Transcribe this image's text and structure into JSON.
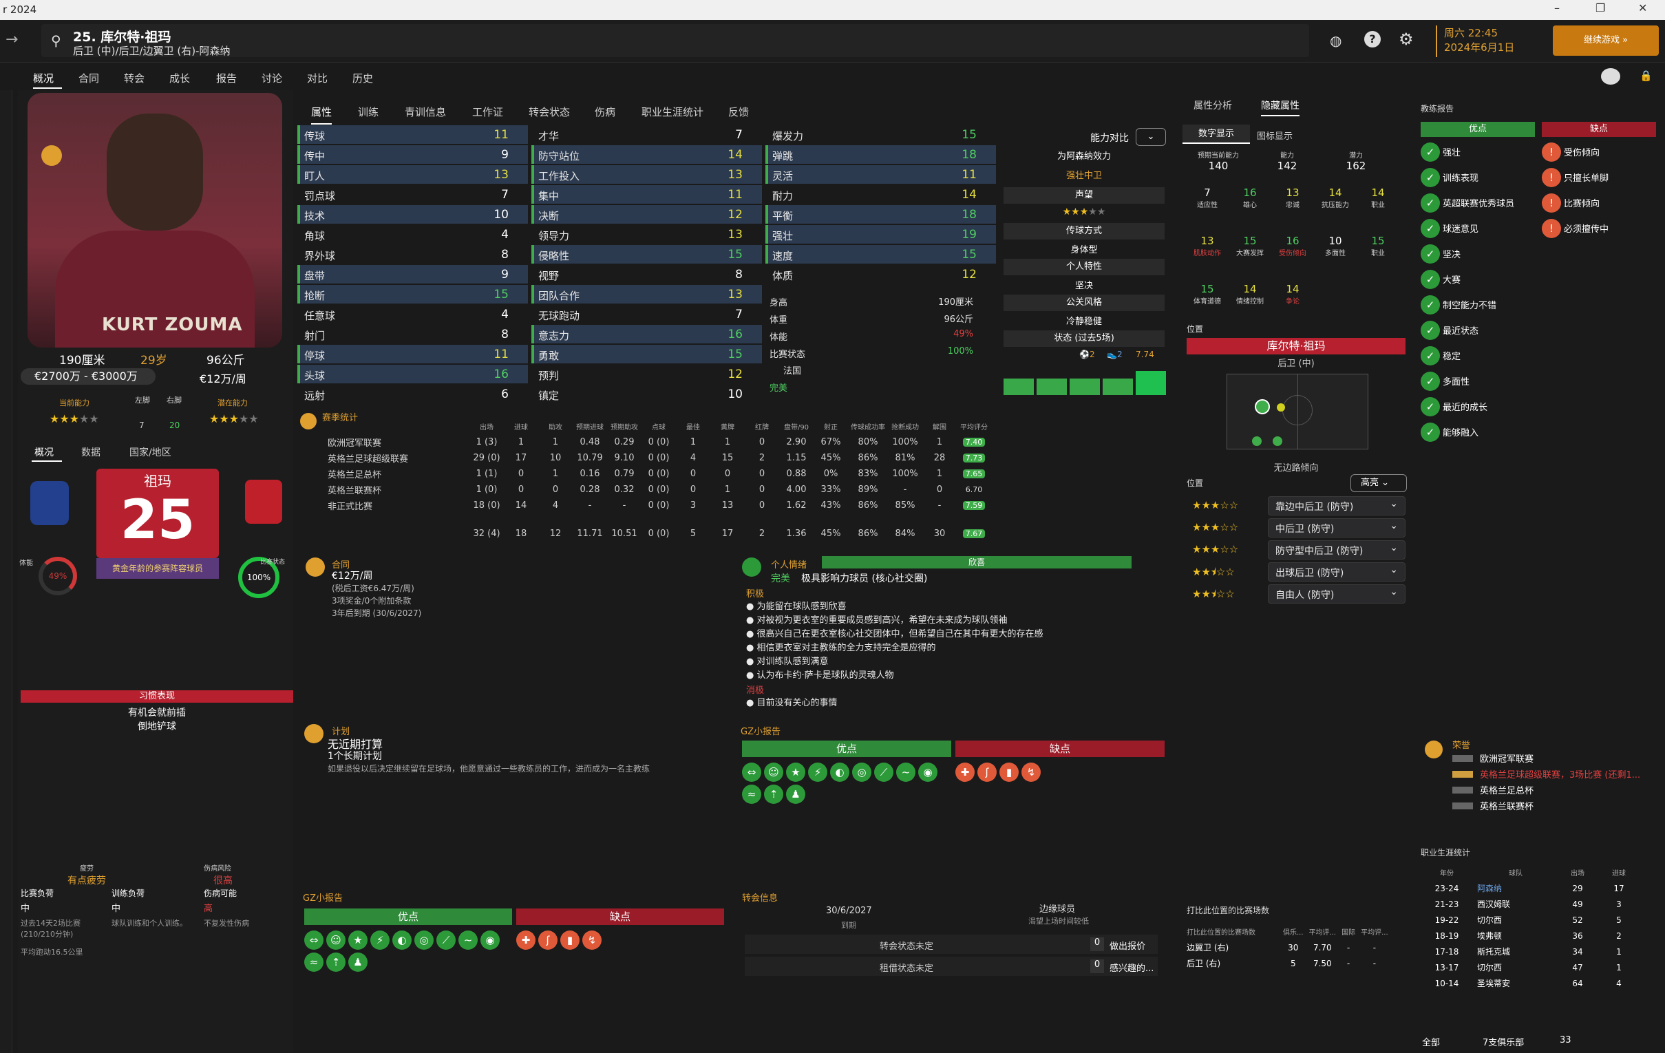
{
  "window": {
    "title": "r 2024"
  },
  "header": {
    "player_title": "25. 库尔特·祖玛",
    "positions": "后卫 (中)/后卫/边翼卫 (右)-阿森纳",
    "datetime_day": "周六 22:45",
    "datetime_date": "2024年6月1日",
    "continue_label": "继续游戏"
  },
  "nav": [
    "概况",
    "合同",
    "转会",
    "成长",
    "报告",
    "讨论",
    "对比",
    "历史"
  ],
  "profile": {
    "photo_name": "KURT ZOUMA",
    "height": "190厘米",
    "age": "29岁",
    "weight": "96公斤",
    "value": "€2700万 - €3000万",
    "wage": "€12万/周",
    "current_ability_label": "当前能力",
    "potential_ability_label": "潜在能力",
    "left_foot_label": "左脚",
    "right_foot_label": "右脚",
    "left_foot": "7",
    "right_foot": "20",
    "tabs": [
      "概况",
      "数据",
      "国家/地区"
    ],
    "kit_name": "祖玛",
    "kit_number": "25",
    "status_label": "黄金年龄的参赛阵容球员",
    "morale_label": "体能",
    "morale_pct": "49%",
    "match_label": "比赛状态",
    "match_pct": "100%",
    "habits_title": "习惯表现",
    "habits": [
      "有机会就前插",
      "倒地铲球"
    ],
    "fatigue_label": "疲劳",
    "fatigue_val": "有点疲劳",
    "injury_label": "伤病风险",
    "injury_val": "很高",
    "load_labels": [
      "比赛负荷",
      "训练负荷",
      "伤病可能"
    ],
    "load_vals": [
      "中",
      "中",
      "高"
    ],
    "load_notes": [
      "过去14天2场比赛 (210/210分钟)",
      "球队训练和个人训练。",
      "不复发性伤病"
    ],
    "avg_run": "平均跑动16.5公里"
  },
  "attr_tabs": [
    "属性",
    "训练",
    "青训信息",
    "工作证",
    "转会状态",
    "伤病",
    "职业生涯统计",
    "反馈"
  ],
  "attrs_tech": [
    [
      "传球",
      "11"
    ],
    [
      "传中",
      "9"
    ],
    [
      "盯人",
      "13"
    ],
    [
      "罚点球",
      "7"
    ],
    [
      "技术",
      "10"
    ],
    [
      "角球",
      "4"
    ],
    [
      "界外球",
      "8"
    ],
    [
      "盘带",
      "9"
    ],
    [
      "抢断",
      "15"
    ],
    [
      "任意球",
      "4"
    ],
    [
      "射门",
      "8"
    ],
    [
      "停球",
      "11"
    ],
    [
      "头球",
      "16"
    ],
    [
      "远射",
      "6"
    ]
  ],
  "attrs_mental": [
    [
      "才华",
      "7"
    ],
    [
      "防守站位",
      "14"
    ],
    [
      "工作投入",
      "13"
    ],
    [
      "集中",
      "11"
    ],
    [
      "决断",
      "12"
    ],
    [
      "领导力",
      "13"
    ],
    [
      "侵略性",
      "15"
    ],
    [
      "视野",
      "8"
    ],
    [
      "团队合作",
      "13"
    ],
    [
      "无球跑动",
      "7"
    ],
    [
      "意志力",
      "16"
    ],
    [
      "勇敢",
      "15"
    ],
    [
      "预判",
      "12"
    ],
    [
      "镇定",
      "10"
    ]
  ],
  "attrs_phys": [
    [
      "爆发力",
      "15"
    ],
    [
      "弹跳",
      "18"
    ],
    [
      "灵活",
      "11"
    ],
    [
      "耐力",
      "14"
    ],
    [
      "平衡",
      "18"
    ],
    [
      "强壮",
      "19"
    ],
    [
      "速度",
      "15"
    ],
    [
      "体质",
      "12"
    ]
  ],
  "phys_info": [
    [
      "身高",
      "190厘米"
    ],
    [
      "体重",
      "96公斤"
    ],
    [
      "体能",
      "49%"
    ],
    [
      "比赛状态",
      "100%"
    ],
    [
      "",
      "法国"
    ],
    [
      "",
      "完美"
    ]
  ],
  "compare": {
    "label": "能力对比",
    "efficiency": "为阿森纳效力",
    "role": "强壮中卫",
    "rep_label": "声望",
    "style_label": "传球方式",
    "style_val": "身体型",
    "trait_label": "个人特性",
    "trait_val": "坚决",
    "pers_label": "公关风格",
    "pers_val": "冷静稳健",
    "form_label": "状态 (过去5场)",
    "form_goals": "2",
    "form_assists": "2",
    "form_rating": "7.74",
    "form_bars": [
      0.5,
      0.5,
      0.5,
      0.5,
      0.72
    ]
  },
  "season_stats": {
    "title": "赛季统计",
    "headers": [
      "出场",
      "进球",
      "助攻",
      "预期进球",
      "预期助攻",
      "点球",
      "最佳",
      "黄牌",
      "红牌",
      "盘带/90",
      "射正",
      "传球成功率",
      "抢断成功",
      "解围",
      "平均评分"
    ],
    "rows": [
      {
        "comp": "欧洲冠军联赛",
        "cells": [
          "1 (3)",
          "1",
          "1",
          "0.48",
          "0.29",
          "0 (0)",
          "1",
          "1",
          "0",
          "2.90",
          "67%",
          "80%",
          "100%",
          "1"
        ],
        "rating": "7.40"
      },
      {
        "comp": "英格兰足球超级联赛",
        "cells": [
          "29 (0)",
          "17",
          "10",
          "10.79",
          "9.10",
          "0 (0)",
          "4",
          "15",
          "2",
          "1.15",
          "45%",
          "86%",
          "81%",
          "28"
        ],
        "rating": "7.73"
      },
      {
        "comp": "英格兰足总杯",
        "cells": [
          "1 (1)",
          "0",
          "1",
          "0.16",
          "0.79",
          "0 (0)",
          "0",
          "0",
          "0",
          "0.88",
          "0%",
          "83%",
          "100%",
          "1"
        ],
        "rating": "7.65"
      },
      {
        "comp": "英格兰联赛杯",
        "cells": [
          "1 (0)",
          "0",
          "0",
          "0.28",
          "0.32",
          "0 (0)",
          "0",
          "1",
          "0",
          "4.00",
          "33%",
          "89%",
          "-",
          "0"
        ],
        "rating": "6.70"
      },
      {
        "comp": "非正式比赛",
        "cells": [
          "18 (0)",
          "14",
          "4",
          "-",
          "-",
          "0 (0)",
          "3",
          "13",
          "0",
          "1.62",
          "43%",
          "86%",
          "85%",
          "-"
        ],
        "rating": "7.59"
      }
    ],
    "total": {
      "cells": [
        "32 (4)",
        "18",
        "12",
        "11.71",
        "10.51",
        "0 (0)",
        "5",
        "17",
        "2",
        "1.36",
        "45%",
        "86%",
        "84%",
        "30"
      ],
      "rating": "7.67"
    }
  },
  "contract": {
    "title": "合同",
    "wage": "€12万/周",
    "lines": [
      "(税后工资€6.47万/周)",
      "3项奖金/0个附加条款",
      "3年后到期 (30/6/2027)"
    ]
  },
  "plan": {
    "title": "计划",
    "line1": "无近期打算",
    "line2": "1个长期计划",
    "line3": "如果退役以后决定继续留在足球场，他愿意通过一些教练员的工作，进而成为一名主教练"
  },
  "personal": {
    "title": "个人情绪",
    "bar_label": "欣喜",
    "mood": "完美",
    "desc": "极具影响力球员 (核心社交圈)",
    "pos_label": "积极",
    "items": [
      "为能留在球队感到欣喜",
      "对被视为更衣室的重要成员感到高兴，希望在未来成为球队领袖",
      "很高兴自己在更衣室核心社交团体中，但希望自己在其中有更大的存在感",
      "相信更衣室对主教练的全力支持完全是应得的",
      "对训练队感到满意",
      "认为布卡约·萨卡是球队的灵魂人物"
    ],
    "neg_label": "消极",
    "neg_items": [
      "目前没有关心的事情"
    ]
  },
  "gz_report": {
    "title": "GZ小报告",
    "pros_label": "优点",
    "cons_label": "缺点"
  },
  "transfer": {
    "title": "转会信息",
    "date": "30/6/2027",
    "date_label": "到期",
    "role": "边缘球员",
    "role_sub": "渴望上场时间较低",
    "rows": [
      [
        "转会状态未定",
        "0",
        "做出报价"
      ],
      [
        "租借状态未定",
        "0",
        "感兴趣的..."
      ]
    ]
  },
  "analysis": {
    "tabs": [
      "属性分析",
      "隐藏属性"
    ],
    "sub_tabs": [
      "数字显示",
      "图标显示"
    ],
    "top": [
      [
        "预期当前能力",
        "140"
      ],
      [
        "能力",
        "142"
      ],
      [
        "潜力",
        "162"
      ]
    ],
    "grid": [
      [
        "7",
        "适应性"
      ],
      [
        "16",
        "雄心"
      ],
      [
        "13",
        "忠诚"
      ],
      [
        "14",
        "抗压能力"
      ],
      [
        "14",
        "职业"
      ],
      [
        "13",
        "肌肤动作"
      ],
      [
        "15",
        "大赛发挥"
      ],
      [
        "16",
        "受伤倾向"
      ],
      [
        "10",
        "多面性"
      ],
      [
        "15",
        "职业"
      ],
      [
        "15",
        "体育道德"
      ],
      [
        "14",
        "情绪控制"
      ],
      [
        "14",
        "争论"
      ]
    ]
  },
  "position": {
    "title": "位置",
    "name": "库尔特·祖玛",
    "pos": "后卫 (中)",
    "foot_label": "无边路倾向",
    "pos_label": "位置",
    "hl_label": "高亮",
    "roles": [
      [
        "靠边中后卫 (防守)",
        3
      ],
      [
        "中后卫 (防守)",
        3
      ],
      [
        "防守型中后卫 (防守)",
        3
      ],
      [
        "出球后卫 (防守)",
        2.5
      ],
      [
        "自由人 (防守)",
        2.5
      ]
    ]
  },
  "pos_games": {
    "title": "打比此位置的比赛场数",
    "headers": [
      "打比此位置的比赛场数",
      "俱乐...",
      "平均评...",
      "国际",
      "平均评..."
    ],
    "rows": [
      [
        "边翼卫 (右)",
        "30",
        "7.70",
        "-",
        "-"
      ],
      [
        "后卫 (右)",
        "5",
        "7.50",
        "-",
        "-"
      ]
    ]
  },
  "coach": {
    "title": "教练报告",
    "pros_label": "优点",
    "cons_label": "缺点",
    "pros": [
      "强壮",
      "训练表现",
      "英超联赛优秀球员",
      "球迷意见",
      "坚决",
      "大赛",
      "制空能力不错",
      "最近状态",
      "稳定",
      "多面性",
      "最近的成长",
      "能够融入"
    ],
    "cons": [
      "受伤倾向",
      "只擅长单脚",
      "比赛倾向",
      "必须擅传中"
    ]
  },
  "honours": {
    "title": "荣誉",
    "items": [
      "欧洲冠军联赛",
      "英格兰足球超级联赛，3场比赛 (还剩1...",
      "英格兰足总杯",
      "英格兰联赛杯"
    ]
  },
  "career": {
    "title": "职业生涯统计",
    "headers": [
      "年份",
      "球队",
      "出场",
      "进球"
    ],
    "rows": [
      [
        "23-24",
        "阿森纳",
        "29",
        "17"
      ],
      [
        "21-23",
        "西汉姆联",
        "49",
        "3"
      ],
      [
        "19-22",
        "切尔西",
        "52",
        "5"
      ],
      [
        "18-19",
        "埃弗顿",
        "36",
        "2"
      ],
      [
        "17-18",
        "斯托克城",
        "34",
        "1"
      ],
      [
        "13-17",
        "切尔西",
        "47",
        "1"
      ],
      [
        "10-14",
        "圣埃蒂安",
        "64",
        "4"
      ]
    ],
    "footer_left": "全部",
    "footer_right": "7支俱乐部",
    "footer_num": "33"
  },
  "colors": {
    "accent": "#e0a030",
    "green": "#2f8a3a",
    "red": "#b7202e"
  }
}
